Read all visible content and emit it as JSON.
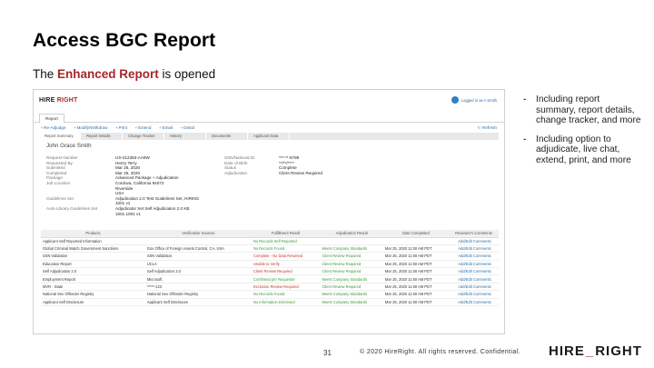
{
  "slide": {
    "title": "Access BGC Report",
    "subtitle_pre": "The ",
    "subtitle_highlight": "Enhanced Report",
    "subtitle_post": " is opened",
    "accent_color": "#a8262b"
  },
  "bullets": [
    "Including report summary, report details, change tracker, and more",
    "Including option to adjudicate, live chat, extend, print, and more"
  ],
  "footer": {
    "page_number": "31",
    "copyright": "© 2020 HireRight. All rights reserved. Confidential.",
    "logo_left": "HIRE",
    "logo_mid": "",
    "logo_right": "RIGHT",
    "logo_tm": "®"
  },
  "screenshot": {
    "app_logo_left": "HIRE",
    "app_logo_right": "RIGHT",
    "user_text": "Logged in as A Smith",
    "tab": "Report",
    "toolbar": [
      {
        "icon": "chat-icon",
        "label": "Re-Adjudge"
      },
      {
        "icon": "calendar-icon",
        "label": "Modify/Withdraw"
      },
      {
        "icon": "print-icon",
        "label": "Print"
      },
      {
        "icon": "extend-icon",
        "label": "Extend"
      },
      {
        "icon": "email-icon",
        "label": "Email"
      },
      {
        "icon": "details-icon",
        "label": "Detail"
      }
    ],
    "refresh": "Refresh",
    "subtabs": [
      "Report Summary",
      "Report Details",
      "Change Tracker",
      "History",
      "Documents",
      "Applicant Data"
    ],
    "person_name": "John Grace Smith",
    "details": [
      {
        "k": "Request Number",
        "v": "US-012353-AA9W",
        "k2": "SSN/National ID",
        "v2": "***-**-6789"
      },
      {
        "k": "Requested By",
        "v": "Henry Terry",
        "k2": "Date of Birth",
        "v2": "**/**/****"
      },
      {
        "k": "Submitted",
        "v": "Mar 25, 2020",
        "k2": "Status",
        "v2": "Complete"
      },
      {
        "k": "Completed",
        "v": "Mar 25, 2020",
        "k2": "Adjudication",
        "v2": "Client Review Required"
      },
      {
        "k": "Package",
        "v": "Advanced Package + Adjudication",
        "k2": "",
        "v2": ""
      },
      {
        "k": "Job Location",
        "v": "Cordova, California 94072",
        "k2": "",
        "v2": ""
      },
      {
        "k": "",
        "v": "Riverside",
        "k2": "",
        "v2": ""
      },
      {
        "k": "",
        "v": "USA",
        "k2": "",
        "v2": ""
      },
      {
        "k": "Guidelines Set",
        "v": "Adjudication 2.0 Test Guidelines Set, HIRING",
        "k2": "",
        "v2": ""
      },
      {
        "k": "",
        "v": "1001 v1",
        "k2": "",
        "v2": ""
      },
      {
        "k": "Auto-Library Guidelines Set",
        "v": "Adjudicator Set Self Adjudication 2.0 KB",
        "k2": "",
        "v2": ""
      },
      {
        "k": "",
        "v": "1001 1001 v1",
        "k2": "",
        "v2": ""
      }
    ],
    "table_headers": [
      "Products",
      "Verification Sources",
      "Fulfillment Result",
      "Adjudication Result",
      "Date Completed",
      "Reviewer's Comments"
    ],
    "table_rows": [
      {
        "product": "Applicant Self Reported Information",
        "source": "",
        "result": "No Records Self Reported",
        "result_status": "ok",
        "adj": "",
        "date": "",
        "comment": "Add/Edit Comments"
      },
      {
        "product": "Global Criminal Watch Government Sanctions",
        "source": "Gov Office of Foreign Assets Control, CA, USA",
        "result": "No Records Found",
        "result_status": "ok",
        "adj": "Meets Company Standards",
        "date": "Mar 25, 2020 11:50 AM PDT",
        "comment": "Add/Edit Comments"
      },
      {
        "product": "SSN Validation",
        "source": "SSN Validation",
        "result": "Complete - No Data Returned",
        "result_status": "bad",
        "adj": "Client Review Required",
        "date": "Mar 25, 2020 11:50 AM PDT",
        "comment": "Add/Edit Comments"
      },
      {
        "product": "Education Report",
        "source": "UCLA",
        "result": "Unable to Verify",
        "result_status": "bad",
        "adj": "Client Review Required",
        "date": "Mar 25, 2020 11:50 AM PDT",
        "comment": "Add/Edit Comments"
      },
      {
        "product": "Self Adjudication 2.0",
        "source": "Self Adjudication 2.0",
        "result": "Client Review Required",
        "result_status": "bad",
        "adj": "Client Review Required",
        "date": "Mar 25, 2020 11:50 AM PDT",
        "comment": "Add/Edit Comments"
      },
      {
        "product": "Employment Report",
        "source": "Microsoft",
        "result": "Confirmed per Requester",
        "result_status": "ok",
        "adj": "Meets Company Standards",
        "date": "Mar 25, 2020 11:50 AM PDT",
        "comment": "Add/Edit Comments"
      },
      {
        "product": "MVR - State",
        "source": "*****-123",
        "result": "Exclusion Review Required",
        "result_status": "bad",
        "adj": "Client Review Required",
        "date": "Mar 25, 2020 11:50 AM PDT",
        "comment": "Add/Edit Comments"
      },
      {
        "product": "National Sex Offender Registry",
        "source": "National Sex Offender Registry",
        "result": "No Records Found",
        "result_status": "ok",
        "adj": "Meets Company Standards",
        "date": "Mar 25, 2020 11:50 AM PDT",
        "comment": "Add/Edit Comments"
      },
      {
        "product": "Applicant Self Disclosure",
        "source": "Applicant Self Disclosure",
        "result": "No Information Disclosed",
        "result_status": "ok",
        "adj": "Meets Company Standards",
        "date": "Mar 25, 2020 11:50 AM PDT",
        "comment": "Add/Edit Comments"
      }
    ]
  }
}
